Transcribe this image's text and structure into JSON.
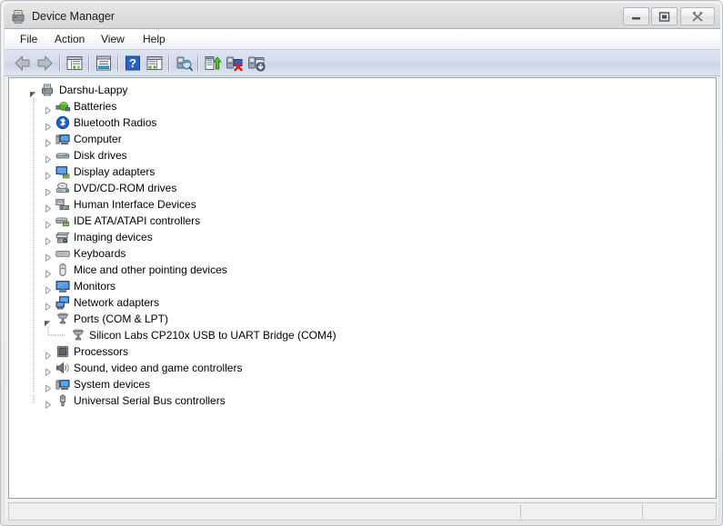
{
  "window": {
    "title": "Device Manager",
    "title_icon": "device-manager-icon",
    "buttons": {
      "minimize": "Minimize",
      "maximize": "Maximize",
      "close": "Close"
    }
  },
  "menu": {
    "items": [
      {
        "label": "File",
        "name": "menu-file"
      },
      {
        "label": "Action",
        "name": "menu-action"
      },
      {
        "label": "View",
        "name": "menu-view"
      },
      {
        "label": "Help",
        "name": "menu-help"
      }
    ]
  },
  "toolbar": {
    "buttons": [
      {
        "name": "back-icon",
        "tooltip": "Back"
      },
      {
        "name": "forward-icon",
        "tooltip": "Forward"
      },
      {
        "name": "show-hide-tree-icon",
        "tooltip": "Show/Hide Console Tree"
      },
      {
        "name": "properties-icon",
        "tooltip": "Properties"
      },
      {
        "name": "help-icon",
        "tooltip": "Help"
      },
      {
        "name": "show-hide-pane-icon",
        "tooltip": "Show/Hide Action Pane"
      },
      {
        "name": "scan-hardware-changes-icon",
        "tooltip": "Scan for hardware changes"
      },
      {
        "name": "update-driver-icon",
        "tooltip": "Update Driver Software"
      },
      {
        "name": "disable-device-icon",
        "tooltip": "Disable"
      },
      {
        "name": "uninstall-device-icon",
        "tooltip": "Uninstall"
      }
    ]
  },
  "tree": {
    "root": {
      "label": "Darshu-Lappy",
      "icon": "computer-root-icon",
      "expanded": true,
      "indent": 0
    },
    "items": [
      {
        "label": "Batteries",
        "icon": "battery-icon",
        "expanded": false,
        "expandable": true
      },
      {
        "label": "Bluetooth Radios",
        "icon": "bluetooth-icon",
        "expanded": false,
        "expandable": true
      },
      {
        "label": "Computer",
        "icon": "computer-icon",
        "expanded": false,
        "expandable": true
      },
      {
        "label": "Disk drives",
        "icon": "disk-drive-icon",
        "expanded": false,
        "expandable": true
      },
      {
        "label": "Display adapters",
        "icon": "display-adapter-icon",
        "expanded": false,
        "expandable": true
      },
      {
        "label": "DVD/CD-ROM drives",
        "icon": "dvd-drive-icon",
        "expanded": false,
        "expandable": true
      },
      {
        "label": "Human Interface Devices",
        "icon": "hid-icon",
        "expanded": false,
        "expandable": true
      },
      {
        "label": "IDE ATA/ATAPI controllers",
        "icon": "ide-controller-icon",
        "expanded": false,
        "expandable": true
      },
      {
        "label": "Imaging devices",
        "icon": "imaging-device-icon",
        "expanded": false,
        "expandable": true
      },
      {
        "label": "Keyboards",
        "icon": "keyboard-icon",
        "expanded": false,
        "expandable": true
      },
      {
        "label": "Mice and other pointing devices",
        "icon": "mouse-icon",
        "expanded": false,
        "expandable": true
      },
      {
        "label": "Monitors",
        "icon": "monitor-icon",
        "expanded": false,
        "expandable": true
      },
      {
        "label": "Network adapters",
        "icon": "network-adapter-icon",
        "expanded": false,
        "expandable": true
      },
      {
        "label": "Ports (COM & LPT)",
        "icon": "port-icon",
        "expanded": true,
        "expandable": true
      },
      {
        "label": "Processors",
        "icon": "processor-icon",
        "expanded": false,
        "expandable": true
      },
      {
        "label": "Sound, video and game controllers",
        "icon": "sound-icon",
        "expanded": false,
        "expandable": true
      },
      {
        "label": "System devices",
        "icon": "system-device-icon",
        "expanded": false,
        "expandable": true
      },
      {
        "label": "Universal Serial Bus controllers",
        "icon": "usb-controller-icon",
        "expanded": false,
        "expandable": true
      }
    ],
    "ports_children": [
      {
        "label": "Silicon Labs CP210x USB to UART Bridge (COM4)",
        "icon": "port-icon"
      }
    ]
  },
  "statusbar": {
    "segments": [
      "",
      "",
      ""
    ]
  },
  "colors": {
    "titlebar": "#dedede",
    "menubar": "#eef1f8",
    "toolbar": "#d6dcec",
    "client": "#ffffff",
    "statusbar": "#f1eff0",
    "text": "#000000",
    "accent_blue": "#2a62c4",
    "green": "#4a9b20",
    "red": "#cc2222"
  }
}
